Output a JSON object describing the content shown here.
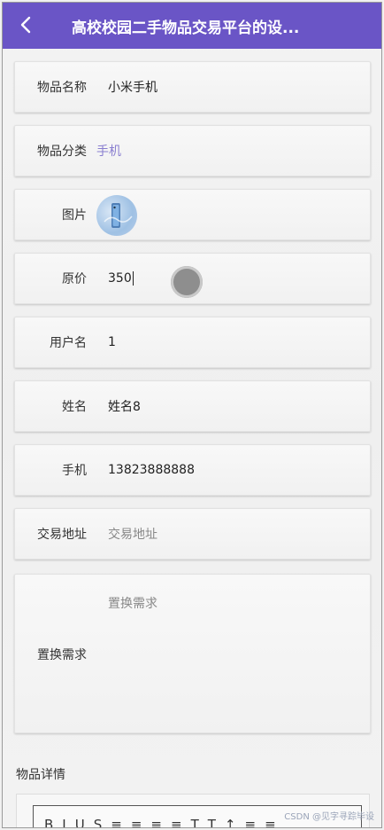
{
  "header": {
    "title": "高校校园二手物品交易平台的设..."
  },
  "fields": {
    "item_name": {
      "label": "物品名称",
      "value": "小米手机"
    },
    "category": {
      "label": "物品分类",
      "value": "手机"
    },
    "image": {
      "label": "图片"
    },
    "price": {
      "label": "原价",
      "value": "350"
    },
    "username": {
      "label": "用户名",
      "value": "1"
    },
    "name": {
      "label": "姓名",
      "value": "姓名8"
    },
    "phone": {
      "label": "手机",
      "value": "13823888888"
    },
    "address": {
      "label": "交易地址",
      "placeholder": "交易地址"
    },
    "exchange": {
      "label": "置换需求",
      "placeholder": "置换需求"
    }
  },
  "details": {
    "label": "物品详情"
  },
  "toolbar": [
    "B",
    "I",
    "U",
    "S",
    "≡",
    "≡",
    "≡",
    "≡",
    "T",
    "T",
    "↑",
    "≡",
    "≡"
  ],
  "watermark": "CSDN @见字寻踪毕设"
}
